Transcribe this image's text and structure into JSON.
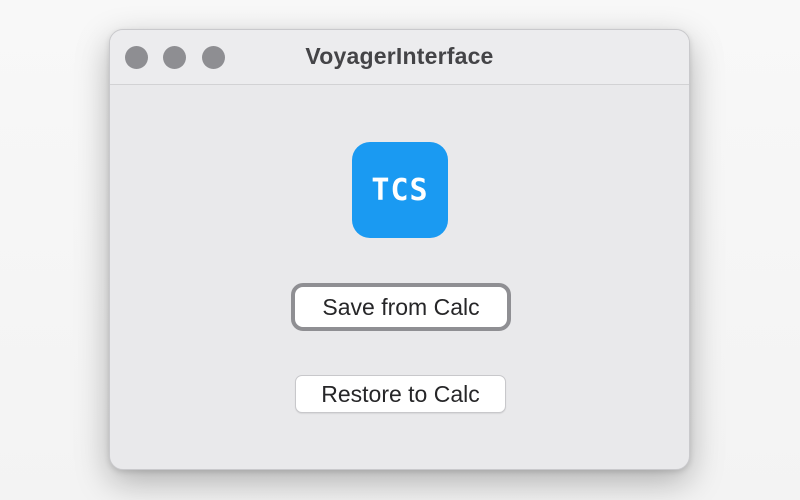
{
  "window": {
    "title": "VoyagerInterface"
  },
  "titlebar": {
    "controls": [
      "close",
      "minimize",
      "zoom"
    ]
  },
  "app_icon": {
    "text": "TCS",
    "color": "#1a9af2"
  },
  "buttons": {
    "save_label": "Save from Calc",
    "restore_label": "Restore to Calc"
  },
  "colors": {
    "window_bg": "#e9e9eb",
    "traffic_light": "#8e8e92",
    "focus_ring": "#8f8f93"
  }
}
